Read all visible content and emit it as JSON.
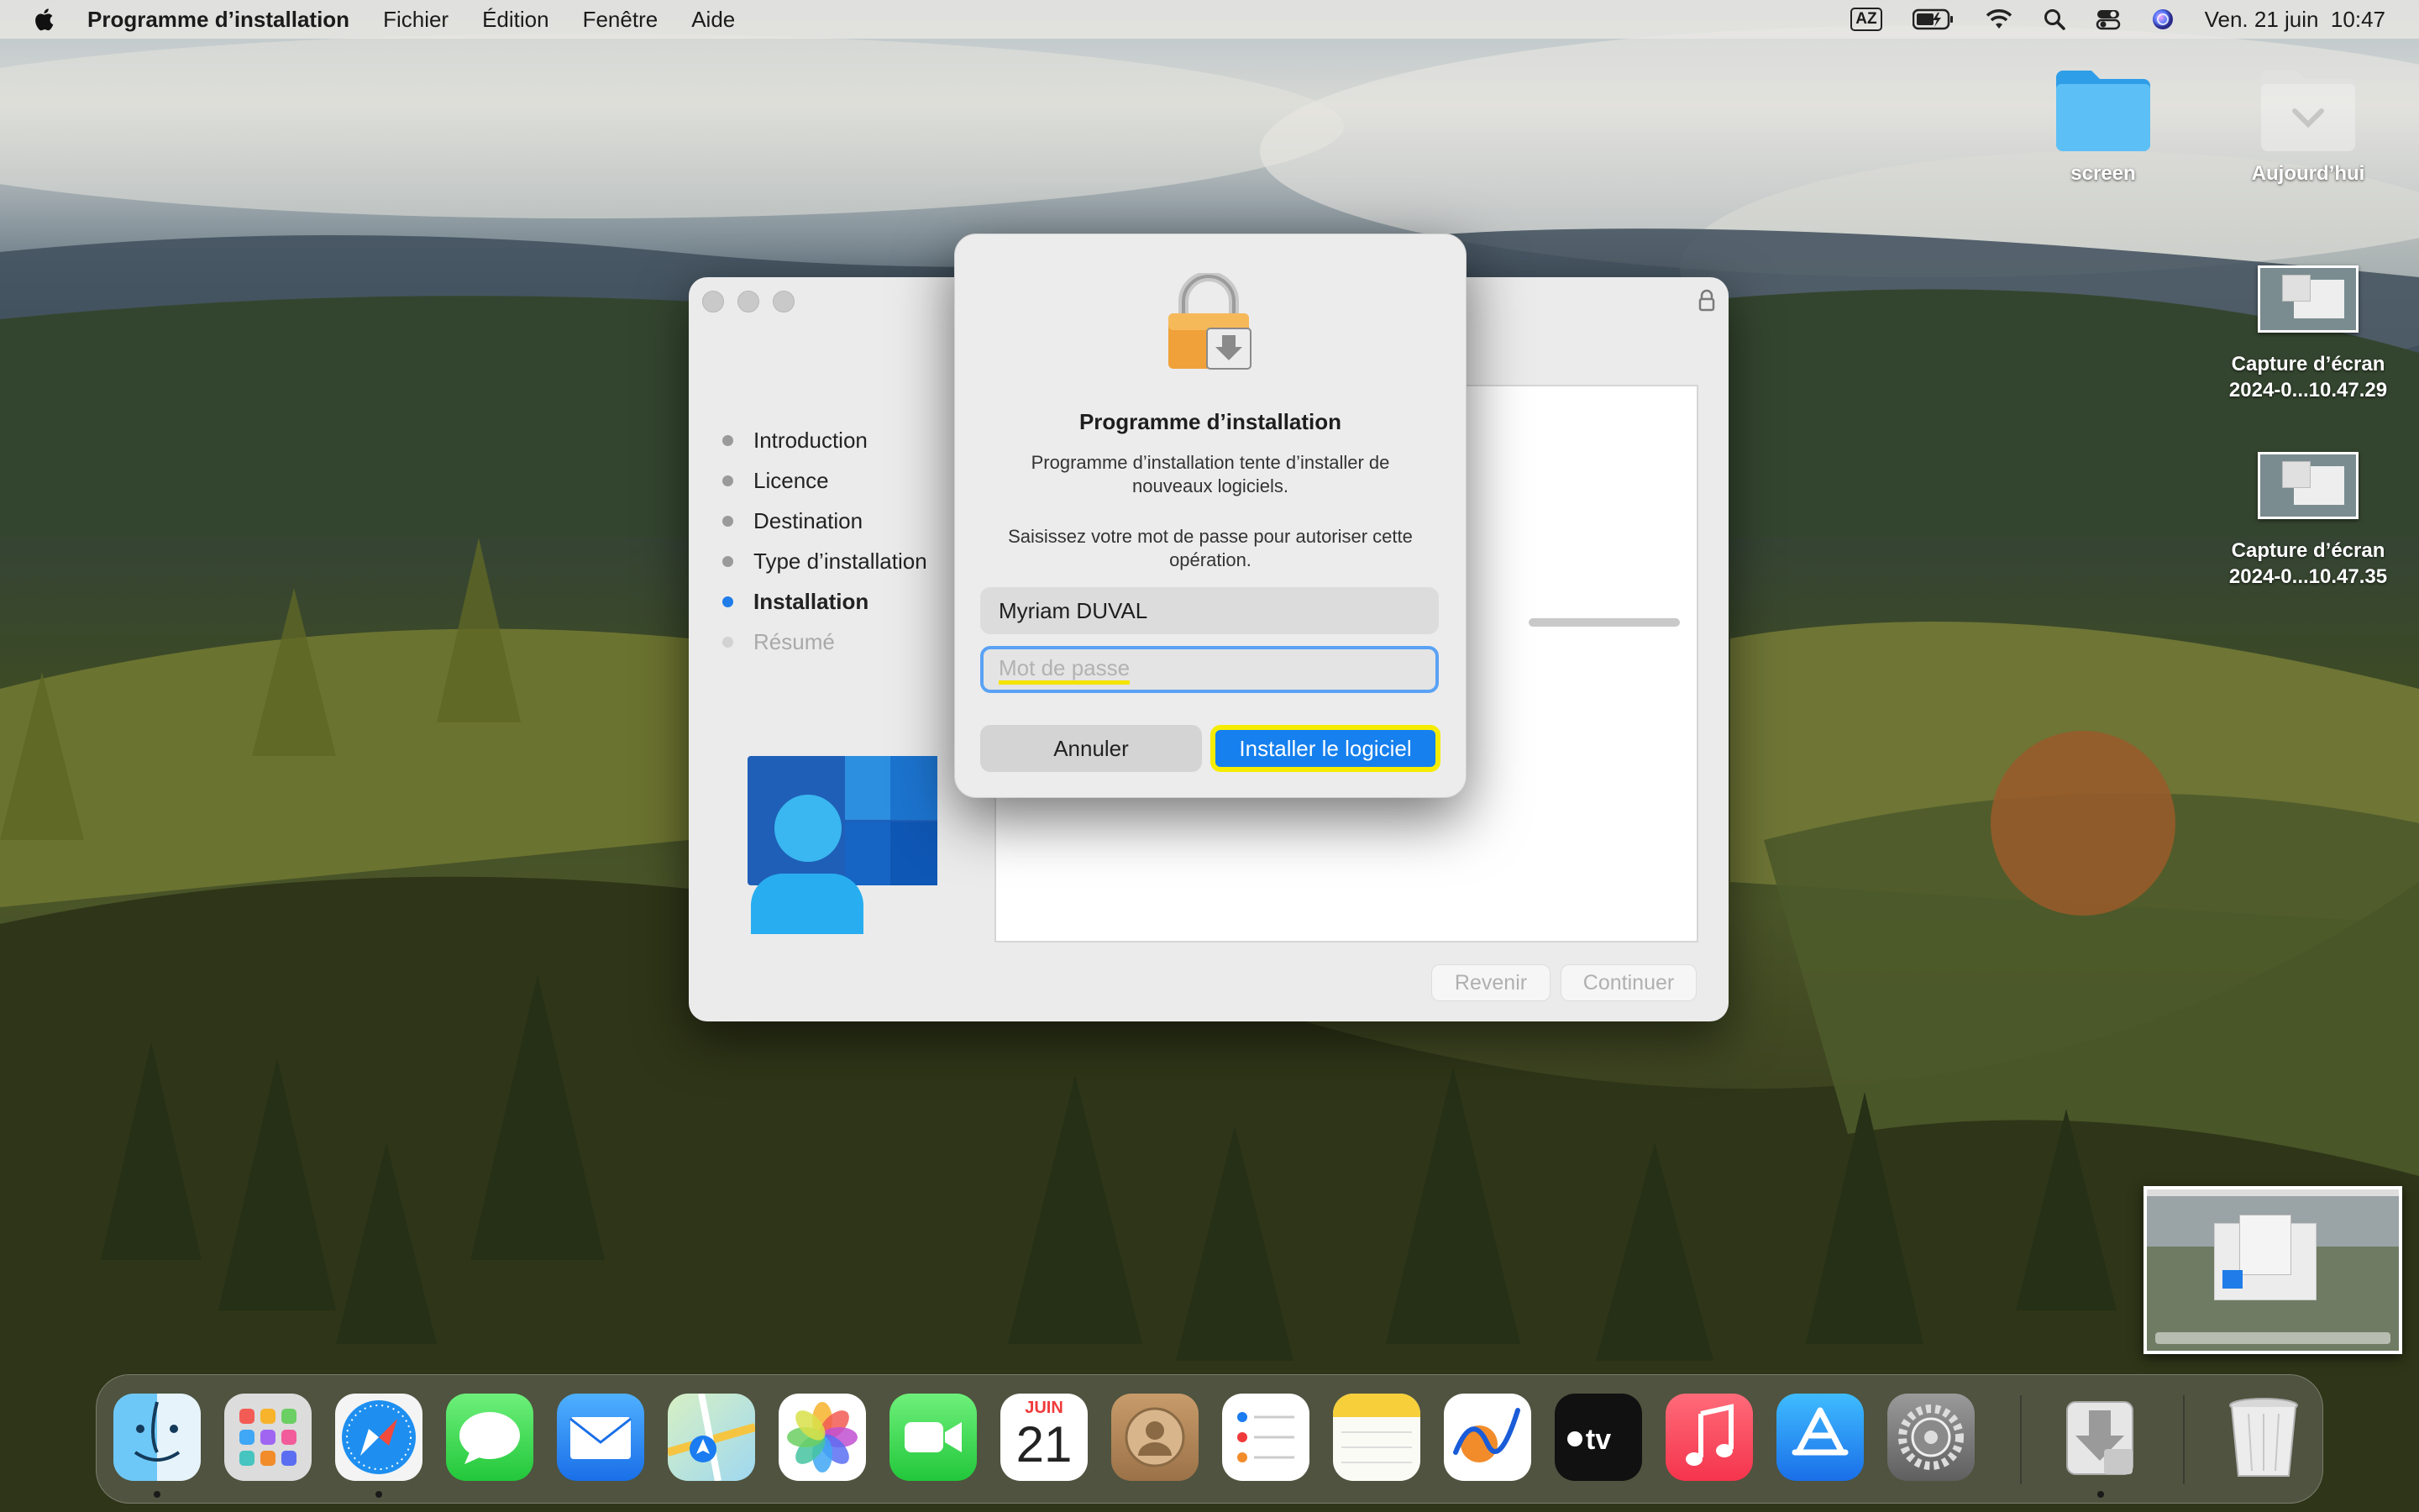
{
  "menubar": {
    "app_name": "Programme d’installation",
    "menus": [
      "Fichier",
      "Édition",
      "Fenêtre",
      "Aide"
    ],
    "keyboard_layout": "AZ",
    "clock": "Ven. 21 juin  10:47"
  },
  "desktop": {
    "icons": [
      {
        "label": "screen",
        "kind": "folder"
      },
      {
        "label": "Aujourd’hui",
        "kind": "folder-dimmed"
      },
      {
        "label_line1": "Capture d’écran",
        "label_line2": "2024-0...10.47.29",
        "kind": "screenshot"
      },
      {
        "label_line1": "Capture d’écran",
        "label_line2": "2024-0...10.47.35",
        "kind": "screenshot"
      }
    ]
  },
  "installer": {
    "steps": [
      {
        "label": "Introduction",
        "state": "done"
      },
      {
        "label": "Licence",
        "state": "done"
      },
      {
        "label": "Destination",
        "state": "done"
      },
      {
        "label": "Type d’installation",
        "state": "done"
      },
      {
        "label": "Installation",
        "state": "active"
      },
      {
        "label": "Résumé",
        "state": "pending"
      }
    ],
    "back_button": "Revenir",
    "continue_button": "Continuer"
  },
  "auth_dialog": {
    "title": "Programme d’installation",
    "message1": "Programme d’installation tente d’installer de nouveaux logiciels.",
    "message2": "Saisissez votre mot de passe pour autoriser cette opération.",
    "username_value": "Myriam DUVAL",
    "password_placeholder": "Mot de passe",
    "cancel_button": "Annuler",
    "ok_button": "Installer le logiciel"
  },
  "dock": {
    "calendar_month": "JUIN",
    "calendar_day": "21",
    "apps": [
      "finder-icon",
      "launchpad-icon",
      "safari-icon",
      "messages-icon",
      "mail-icon",
      "maps-icon",
      "photos-icon",
      "facetime-icon",
      "calendar-icon",
      "contacts-icon",
      "reminders-icon",
      "notes-icon",
      "freeform-icon",
      "apple-tv-icon",
      "music-icon",
      "app-store-icon",
      "system-settings-icon",
      "installer-icon",
      "trash-icon"
    ]
  },
  "colors": {
    "accent": "#1680ee",
    "highlight": "#f6ec00",
    "focus_ring": "#5aa2f5"
  }
}
